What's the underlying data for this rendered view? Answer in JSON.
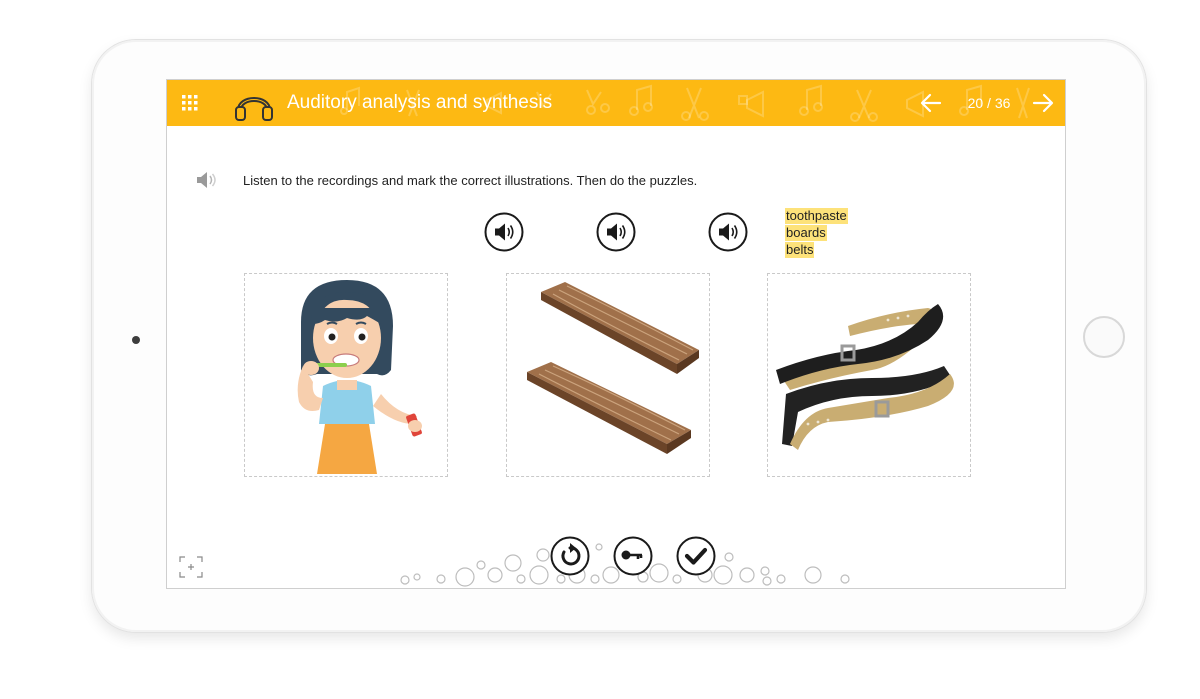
{
  "header": {
    "title": "Auditory analysis and synthesis",
    "counter": "20 / 36",
    "menu_icon": "grid-icon",
    "section_icon": "headphones-icon",
    "prev_icon": "arrow-left-icon",
    "next_icon": "arrow-right-icon"
  },
  "task": {
    "instruction": "Listen to the recordings and mark the correct illustrations. Then do the puzzles.",
    "recordings": [
      "speaker-icon",
      "speaker-icon",
      "speaker-icon"
    ],
    "words": [
      "toothpaste",
      "boards",
      "belts"
    ],
    "cards": [
      "girl-brushing-teeth",
      "wooden-boards",
      "leather-belts"
    ]
  },
  "controls": {
    "reset_icon": "reset-icon",
    "key_icon": "key-icon",
    "check_icon": "check-icon",
    "fullscreen_icon": "fullscreen-icon"
  },
  "colors": {
    "accent": "#fdb913",
    "word_highlight": "#fde27a"
  }
}
